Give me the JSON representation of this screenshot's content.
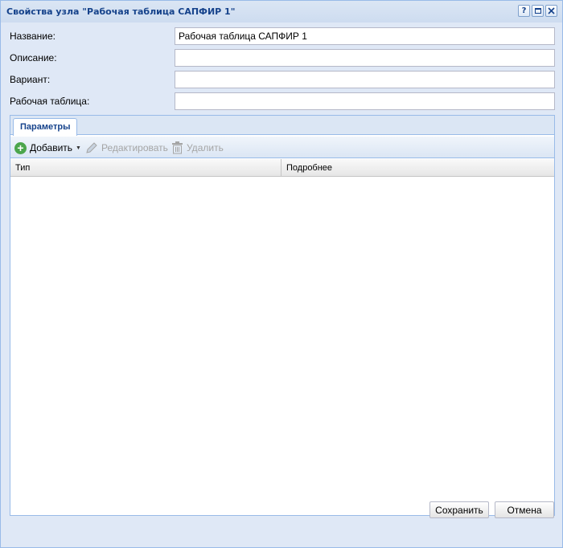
{
  "window": {
    "title": "Свойства узла \"Рабочая таблица САПФИР 1\"",
    "tools": {
      "help": "?"
    }
  },
  "form": {
    "name_label": "Название:",
    "name_value": "Рабочая таблица САПФИР 1",
    "description_label": "Описание:",
    "description_value": "",
    "variant_label": "Вариант:",
    "variant_value": "",
    "worksheet_label": "Рабочая таблица:",
    "worksheet_value": ""
  },
  "tabs": [
    {
      "label": "Параметры",
      "active": true
    }
  ],
  "toolbar": {
    "add_label": "Добавить",
    "edit_label": "Редактировать",
    "delete_label": "Удалить"
  },
  "grid": {
    "columns": [
      "Тип",
      "Подробнее"
    ],
    "rows": []
  },
  "footer": {
    "save_label": "Сохранить",
    "cancel_label": "Отмена"
  },
  "colors": {
    "accent": "#15428b",
    "border": "#99bbe8",
    "panel_bg": "#dfe8f6",
    "add_icon": "#4ca64c"
  }
}
